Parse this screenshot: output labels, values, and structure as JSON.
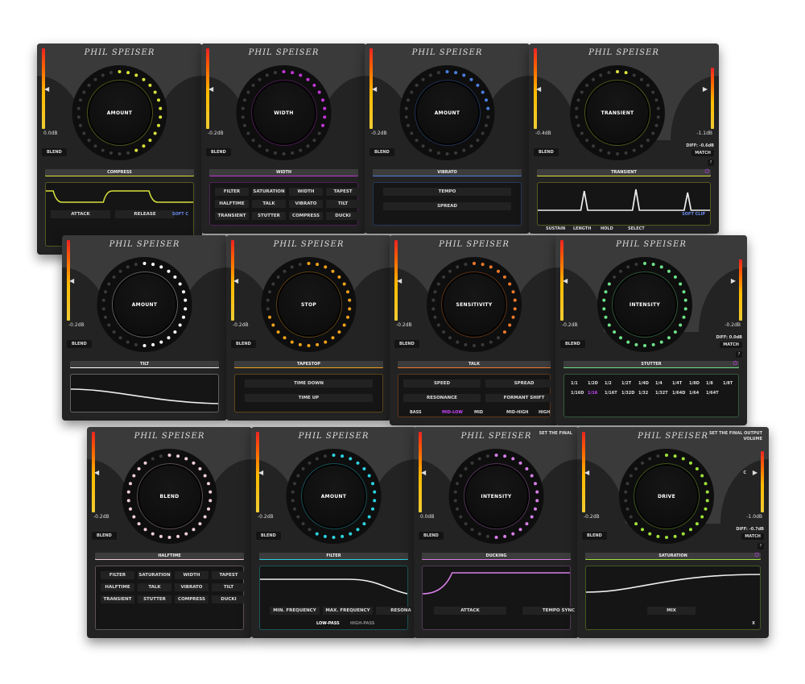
{
  "brand": "PHIL SPEISER",
  "plugins": [
    {
      "id": "compress",
      "knob": "AMOUNT",
      "section": "COMPRESS",
      "blend": "BLEND",
      "meter": "0.0dB",
      "accent": "#d9e23a",
      "buttons": [
        "ATTACK",
        "RELEASE"
      ],
      "soft_clip": "SOFT C"
    },
    {
      "id": "width",
      "knob": "WIDTH",
      "section": "WIDTH",
      "blend": "BLEND",
      "meter": "-0.2dB",
      "accent": "#c236d6",
      "grid": [
        "FILTER",
        "SATURATION",
        "WIDTH",
        "TAPEST",
        "HALFTIME",
        "TALK",
        "VIBRATO",
        "TILT",
        "TRANSIENT",
        "STUTTER",
        "COMPRESS",
        "DUCKI"
      ]
    },
    {
      "id": "vibrato",
      "knob": "AMOUNT",
      "section": "VIBRATO",
      "blend": "BLEND",
      "meter": "-0.2dB",
      "accent": "#4b7fe0",
      "buttons": [
        "TEMPO",
        "SPREAD"
      ]
    },
    {
      "id": "transient",
      "knob": "TRANSIENT",
      "section": "TRANSIENT",
      "blend": "BLEND",
      "meter": "-0.4dB",
      "meter_r": "-1.1dB",
      "diff": "DIFF: -0.6dB",
      "match": "MATCH",
      "q": "?",
      "accent": "#d9e23a",
      "minis": [
        "SUSTAIN",
        "LENGTH",
        "HOLD",
        "SELECT"
      ],
      "soft_clip": "SOFT CLIP"
    },
    {
      "id": "tilt",
      "knob": "AMOUNT",
      "section": "TILT",
      "blend": "BLEND",
      "meter": "-0.2dB",
      "accent": "#ffffff"
    },
    {
      "id": "tapestop",
      "knob": "STOP",
      "section": "TAPESTOP",
      "blend": "BLEND",
      "meter": "-0.2dB",
      "accent": "#f0a21a",
      "buttons": [
        "TIME DOWN",
        "TIME UP"
      ]
    },
    {
      "id": "talk",
      "knob": "SENSITIVITY",
      "section": "TALK",
      "blend": "BLEND",
      "meter": "-0.2dB",
      "accent": "#ef7a2a",
      "buttons": [
        "SPEED",
        "SPREAD",
        "RESONANCE",
        "FORMANT SHIFT"
      ],
      "bands": [
        "BASS",
        "MID-LOW",
        "MID",
        "MID-HIGH",
        "HIGH"
      ]
    },
    {
      "id": "stutter",
      "knob": "INTENSITY",
      "section": "STUTTER",
      "blend": "BLEND",
      "meter": "-0.2dB",
      "meter_r": "-0.2dB",
      "diff": "DIFF: 0.0dB",
      "match": "MATCH",
      "q": "?",
      "accent": "#6fe28a",
      "row1": [
        "1/1",
        "1/2D",
        "1/2",
        "1/2T",
        "1/4D",
        "1/4",
        "1/4T",
        "1/8D",
        "1/8",
        "1/8T"
      ],
      "row2": [
        "1/16D",
        "1/16",
        "1/16T",
        "1/32D",
        "1/32",
        "1/32T",
        "1/64D",
        "1/64",
        "1/64T"
      ]
    },
    {
      "id": "halftime",
      "knob": "BLEND",
      "section": "HALFTIME",
      "blend": "BLEND",
      "meter": "-0.2dB",
      "accent": "#f0d0d8",
      "grid": [
        "FILTER",
        "SATURATION",
        "WIDTH",
        "TAPEST",
        "HALFTIME",
        "TALK",
        "VIBRATO",
        "TILT",
        "TRANSIENT",
        "STUTTER",
        "COMPRESS",
        "DUCKI"
      ]
    },
    {
      "id": "filter",
      "knob": "AMOUNT",
      "section": "FILTER",
      "blend": "BLEND",
      "meter": "-0.2dB",
      "accent": "#2ad2e2",
      "buttons": [
        "MIN. FREQUENCY",
        "MAX. FREQUENCY",
        "RESONA"
      ],
      "modes": [
        "LOW-PASS",
        "HIGH-PASS"
      ]
    },
    {
      "id": "ducking",
      "knob": "INTENSITY",
      "section": "DUCKING",
      "blend": "BLEND",
      "meter": "0.0dB",
      "accent": "#d77ee8",
      "buttons": [
        "ATTACK",
        "TEMPO SYNC"
      ],
      "top_note": "SET THE FINAL"
    },
    {
      "id": "saturation",
      "knob": "DRIVE",
      "section": "SATURATION",
      "blend": "BLEND",
      "meter": "-0.2dB",
      "meter_r": "-1.0dB",
      "diff": "DIFF: -0.7dB",
      "match": "MATCH",
      "q": "?",
      "accent": "#9ee23a",
      "buttons": [
        "MIX"
      ],
      "top_note": "SET THE FINAL OUTPUT",
      "top_note2": "VOLUME",
      "c_label": "C",
      "x_label": "X"
    }
  ]
}
